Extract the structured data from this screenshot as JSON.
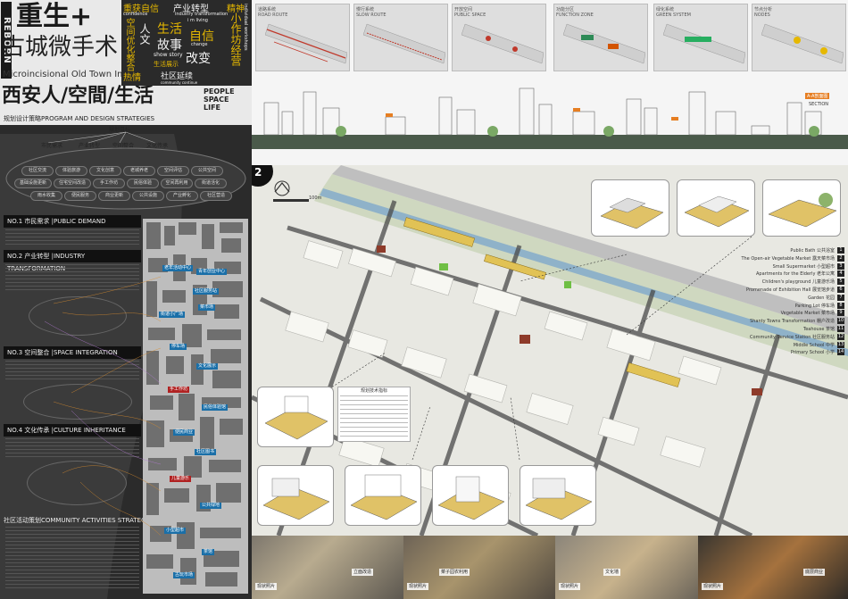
{
  "poster": {
    "side_label": "REBORN",
    "title_main": "重生+",
    "title_sub": "古城微手术",
    "subtitle_en": "Microincisional Old Town Improve",
    "tagline": "西安人/空間/生活",
    "tagline_en": [
      "PEOPLE",
      "SPACE",
      "LIFE"
    ],
    "word_cloud": [
      {
        "text": "重获自信",
        "en": "confidence"
      },
      {
        "text": "产业转型",
        "en": "industry transformation"
      },
      {
        "text": "精神",
        "en": ""
      },
      {
        "text": "生活",
        "en": "i m living"
      },
      {
        "text": "故事",
        "en": ""
      },
      {
        "text": "自信",
        "en": "change"
      },
      {
        "text": "show story",
        "en": ""
      },
      {
        "text": "生活展示",
        "en": ""
      },
      {
        "text": "改变",
        "en": ""
      },
      {
        "text": "热情",
        "en": ""
      },
      {
        "text": "社区延续",
        "en": "community continue"
      },
      {
        "text": "小作坊经营",
        "en": "individual workshops"
      },
      {
        "text": "空间优化整合",
        "en": ""
      },
      {
        "text": "人文",
        "en": ""
      }
    ]
  },
  "strategy": {
    "header": "规划设计策略PROGRAM AND DESIGN STRATEGIES",
    "goal": "规划目标",
    "pillars": [
      "市民需求",
      "产业转型",
      "空间整合",
      "文化传承"
    ],
    "nodes": [
      "社区交流",
      "体验旅游",
      "文化创意",
      "老城养老",
      "空间评估",
      "公共空间",
      "基础设施更新",
      "住宅空间改造",
      "手工作坊",
      "民俗体验",
      "空间再利用",
      "街道活化",
      "雨水收集",
      "便民服务",
      "商业更新",
      "公共设施",
      "产业孵化",
      "社区营造"
    ]
  },
  "sections": [
    {
      "id": "NO.1",
      "title": "市民需求 |PUBLIC DEMAND"
    },
    {
      "id": "NO.2",
      "title": "产业转型 |INDUSTRY TRANSFORMATION"
    },
    {
      "id": "NO.3",
      "title": "空间整合 |SPACE INTEGRATION"
    },
    {
      "id": "NO.4",
      "title": "文化传承 |CULTURE INHERITANCE"
    }
  ],
  "community_header": "社区活动策划COMMUNITY ACTIVITIES STRATEGIES",
  "map_tags": [
    "老年活动中心",
    "青年创业中心",
    "社区服务站",
    "街道小广场",
    "菜市场",
    "停车场",
    "文化展示",
    "手工作坊",
    "民俗体验馆",
    "便民商业",
    "社区图书",
    "儿童游乐",
    "公共绿地",
    "小型超市",
    "茶馆",
    "古玩市场"
  ],
  "top": {
    "plans": [
      {
        "label": "ROAD ROUTE",
        "title": "道路系统"
      },
      {
        "label": "SLOW ROUTE",
        "title": "慢行系统"
      },
      {
        "label": "PUBLIC SPACE",
        "title": "开放空间"
      },
      {
        "label": "FUNCTION ZONE",
        "title": "功能分区"
      },
      {
        "label": "GREEN SYSTEM",
        "title": "绿化系统"
      },
      {
        "label": "NODES",
        "title": "节点分析"
      }
    ],
    "section_label": "A-A剖面图",
    "section_en": "SECTION"
  },
  "plan": {
    "number": "2",
    "tech_table_title": "规划技术指标",
    "legend": [
      {
        "num": "1",
        "text": "Public Bath 公共浴室"
      },
      {
        "num": "2",
        "text": "The Open-air Vegetable Market 露天菜市场"
      },
      {
        "num": "3",
        "text": "Small Supermarket 小型超市"
      },
      {
        "num": "4",
        "text": "Apartments for the Elderly 老年公寓"
      },
      {
        "num": "5",
        "text": "Children's playground 儿童游乐场"
      },
      {
        "num": "6",
        "text": "Promenade of Exhibition Hall 展览馆步道"
      },
      {
        "num": "7",
        "text": "Garden 花园"
      },
      {
        "num": "8",
        "text": "Parking Lot 停车场"
      },
      {
        "num": "9",
        "text": "Vegetable Market 菜市场"
      },
      {
        "num": "10",
        "text": "Shanty Towns Transformation 棚户改造"
      },
      {
        "num": "11",
        "text": "Teahouse 茶馆"
      },
      {
        "num": "12",
        "text": "Community Service Station 社区服务站"
      },
      {
        "num": "13",
        "text": "Middle School 中学"
      },
      {
        "num": "14",
        "text": "Primary School 小学"
      }
    ],
    "scale": "100m"
  },
  "photos": [
    {
      "caption": "立面改造",
      "tag": "现状照片"
    },
    {
      "caption": "菜子园农利用",
      "tag": "现状照片"
    },
    {
      "caption": "文化墙",
      "tag": "现状照片"
    },
    {
      "caption": "底层商业",
      "tag": "现状照片"
    }
  ],
  "colors": {
    "accent_yellow": "#e6b800",
    "panel_dark": "#2b2b2b",
    "tag_blue": "#1a6fa8",
    "tag_red": "#b02222"
  }
}
